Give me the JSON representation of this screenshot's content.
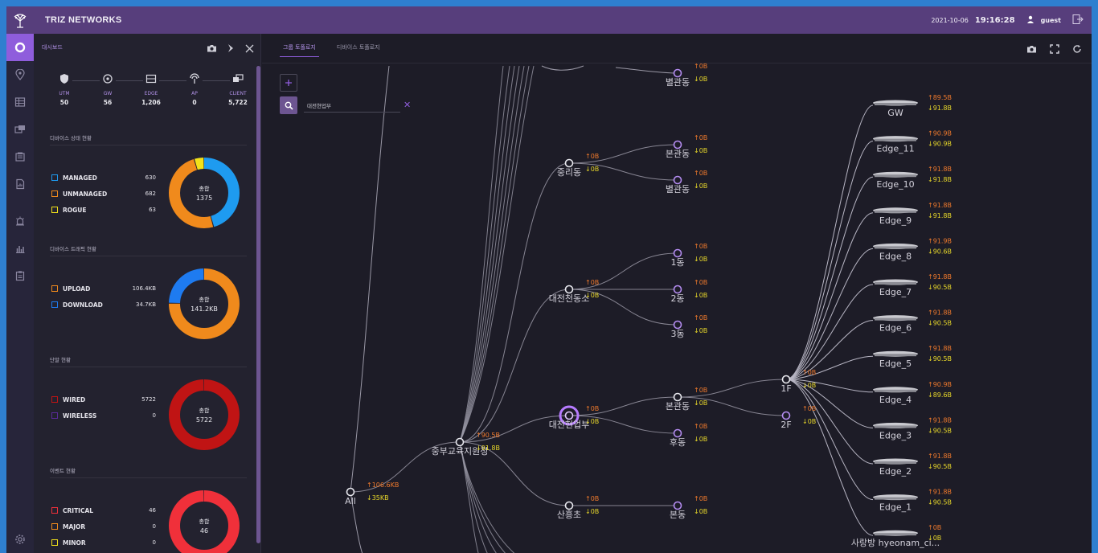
{
  "app": {
    "brand": "TRIZ NETWORKS",
    "date": "2021-10-06",
    "time": "19:16:28",
    "user": "guest"
  },
  "nav": {
    "items": [
      "dashboard-icon",
      "map-pin-icon",
      "table-icon",
      "devices-icon",
      "report-icon",
      "document-chart-icon",
      "alarm-icon",
      "stats-icon",
      "clipboard-icon",
      "settings-icon"
    ]
  },
  "panel": {
    "title": "대시보드",
    "device_types": [
      {
        "label": "UTM",
        "value": "50",
        "icon": "shield-icon"
      },
      {
        "label": "GW",
        "value": "56",
        "icon": "gateway-icon"
      },
      {
        "label": "EDGE",
        "value": "1,206",
        "icon": "edge-icon"
      },
      {
        "label": "AP",
        "value": "0",
        "icon": "ap-icon"
      },
      {
        "label": "CLIENT",
        "value": "5,722",
        "icon": "client-icon"
      }
    ],
    "sections": [
      {
        "title": "디바이스 상태 현황",
        "center_label": "총합",
        "center_value": "1375",
        "items": [
          {
            "label": "MANAGED",
            "value": "630",
            "color": "#1e9bf0"
          },
          {
            "label": "UNMANAGED",
            "value": "682",
            "color": "#f08a1c"
          },
          {
            "label": "ROGUE",
            "value": "63",
            "color": "#f2e21a"
          }
        ],
        "ring": [
          {
            "value": 630,
            "color": "#1e9bf0"
          },
          {
            "value": 682,
            "color": "#f08a1c"
          },
          {
            "value": 63,
            "color": "#f2e21a"
          }
        ]
      },
      {
        "title": "디바이스 트래픽 현황",
        "center_label": "총합",
        "center_value": "141.2KB",
        "items": [
          {
            "label": "UPLOAD",
            "value": "106.4KB",
            "color": "#f08a1c"
          },
          {
            "label": "DOWNLOAD",
            "value": "34.7KB",
            "color": "#1e7bf0"
          }
        ],
        "ring": [
          {
            "value": 106.4,
            "color": "#f08a1c"
          },
          {
            "value": 34.7,
            "color": "#1e7bf0"
          }
        ]
      },
      {
        "title": "단말 현황",
        "center_label": "총합",
        "center_value": "5722",
        "items": [
          {
            "label": "WIRED",
            "value": "5722",
            "color": "#c01414"
          },
          {
            "label": "WIRELESS",
            "value": "0",
            "color": "#5a2a9a"
          }
        ],
        "ring": [
          {
            "value": 5722,
            "color": "#c01414"
          },
          {
            "value": 0,
            "color": "#5a2a9a"
          }
        ]
      },
      {
        "title": "이벤트 현황",
        "center_label": "총합",
        "center_value": "46",
        "items": [
          {
            "label": "CRITICAL",
            "value": "46",
            "color": "#f0303a"
          },
          {
            "label": "MAJOR",
            "value": "0",
            "color": "#f08a1c"
          },
          {
            "label": "MINOR",
            "value": "0",
            "color": "#f2e21a"
          }
        ],
        "ring": [
          {
            "value": 46,
            "color": "#f0303a"
          },
          {
            "value": 0,
            "color": "#f08a1c"
          },
          {
            "value": 0,
            "color": "#f2e21a"
          }
        ]
      }
    ]
  },
  "main": {
    "tabs": [
      {
        "label": "그룹 토폴로지",
        "active": true
      },
      {
        "label": "디바이스 토폴로지",
        "active": false
      }
    ],
    "search_value": "대전현업부"
  },
  "topology": {
    "nodes": [
      {
        "id": "all",
        "label": "All",
        "up": "↑106.6KB",
        "down": "↓35KB"
      },
      {
        "id": "jungbu",
        "label": "중부교육지원청",
        "up": "↑90.5B",
        "down": "↓91.8B"
      },
      {
        "id": "byeolgwan_top",
        "label": "별관동",
        "up": "↑0B",
        "down": "↓0B"
      },
      {
        "id": "jungri",
        "label": "중리동",
        "up": "↑0B",
        "down": "↓0B"
      },
      {
        "id": "bongwan1",
        "label": "본관동",
        "up": "↑0B",
        "down": "↓0B"
      },
      {
        "id": "byeolgwan2",
        "label": "별관동",
        "up": "↑0B",
        "down": "↓0B"
      },
      {
        "id": "daejeon_cheonsan",
        "label": "대전천동소",
        "up": "↑0B",
        "down": "↓0B"
      },
      {
        "id": "dong1",
        "label": "1동",
        "up": "↑0B",
        "down": "↓0B"
      },
      {
        "id": "dong2",
        "label": "2동",
        "up": "↑0B",
        "down": "↓0B"
      },
      {
        "id": "dong3",
        "label": "3동",
        "up": "↑0B",
        "down": "↓0B"
      },
      {
        "id": "daejeon_hyeon",
        "label": "대전현업부",
        "up": "↑0B",
        "down": "↓0B"
      },
      {
        "id": "bongwan2",
        "label": "본관동",
        "up": "↑0B",
        "down": "↓0B"
      },
      {
        "id": "hudong",
        "label": "후동",
        "up": "↑0B",
        "down": "↓0B"
      },
      {
        "id": "floor1",
        "label": "1F",
        "up": "↑0B",
        "down": "↓0B"
      },
      {
        "id": "floor2",
        "label": "2F",
        "up": "↑0B",
        "down": "↓0B"
      },
      {
        "id": "sanheung",
        "label": "산흥초",
        "up": "↑0B",
        "down": "↓0B"
      },
      {
        "id": "bondong",
        "label": "본동",
        "up": "↑0B",
        "down": "↓0B"
      }
    ],
    "devices": [
      {
        "label": "GW",
        "up": "↑89.5B",
        "down": "↓91.8B"
      },
      {
        "label": "Edge_11",
        "up": "↑90.9B",
        "down": "↓90.9B"
      },
      {
        "label": "Edge_10",
        "up": "↑91.8B",
        "down": "↓91.8B"
      },
      {
        "label": "Edge_9",
        "up": "↑91.8B",
        "down": "↓91.8B"
      },
      {
        "label": "Edge_8",
        "up": "↑91.9B",
        "down": "↓90.6B"
      },
      {
        "label": "Edge_7",
        "up": "↑91.8B",
        "down": "↓90.5B"
      },
      {
        "label": "Edge_6",
        "up": "↑91.8B",
        "down": "↓90.5B"
      },
      {
        "label": "Edge_5",
        "up": "↑91.8B",
        "down": "↓90.5B"
      },
      {
        "label": "Edge_4",
        "up": "↑90.9B",
        "down": "↓89.6B"
      },
      {
        "label": "Edge_3",
        "up": "↑91.8B",
        "down": "↓90.5B"
      },
      {
        "label": "Edge_2",
        "up": "↑91.8B",
        "down": "↓90.5B"
      },
      {
        "label": "Edge_1",
        "up": "↑91.8B",
        "down": "↓90.5B"
      },
      {
        "label": "사랑방 hyeonam_ci...",
        "up": "↑0B",
        "down": "↓0B"
      }
    ]
  },
  "colors": {
    "accent": "#8f5ddc",
    "topbar": "#573e7c",
    "up": "#f07a2c",
    "down": "#e8d82a"
  }
}
